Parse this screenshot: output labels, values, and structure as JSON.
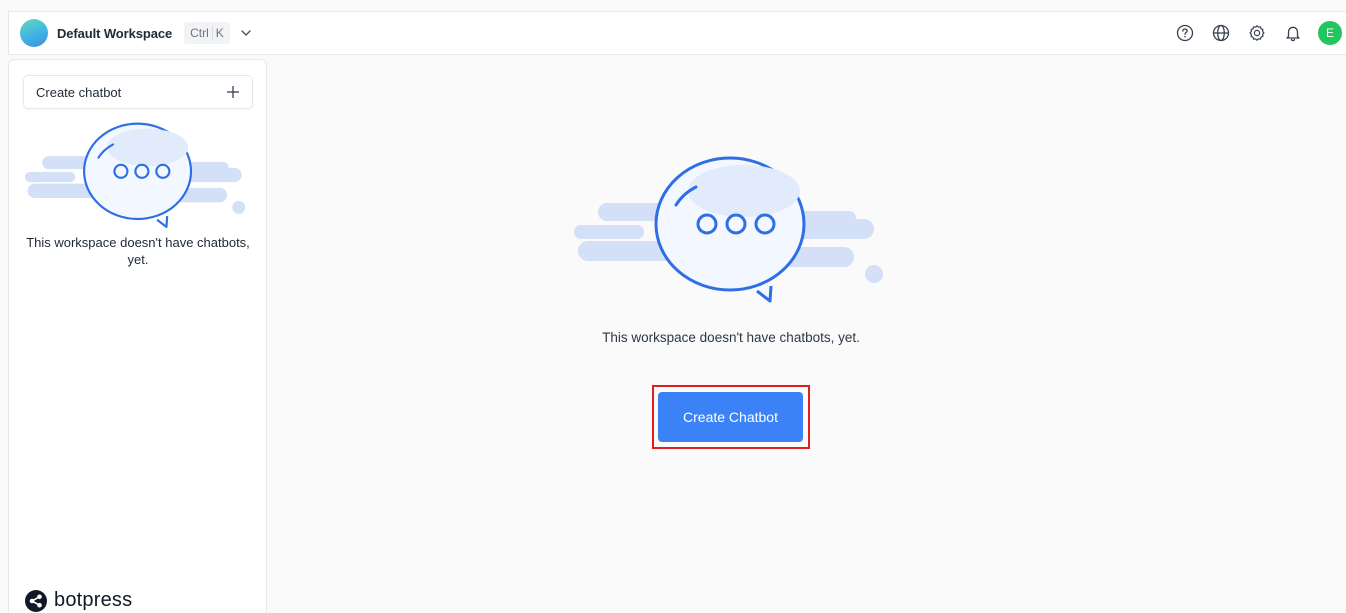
{
  "header": {
    "workspace_name": "Default Workspace",
    "shortcut_keys": [
      "Ctrl",
      "K"
    ],
    "icons": [
      "help-icon",
      "globe-icon",
      "settings-icon",
      "bell-icon"
    ],
    "user_initial": "E",
    "user_avatar_color": "#22c55e"
  },
  "sidebar": {
    "create_label": "Create chatbot",
    "create_icon": "plus-icon",
    "empty_message": "This workspace doesn't have chatbots, yet.",
    "brand_name": "botpress"
  },
  "main": {
    "empty_message": "This workspace doesn't have chatbots, yet.",
    "cta_label": "Create Chatbot",
    "cta_color": "#3b82f6",
    "highlight_color": "#e11d1d"
  }
}
